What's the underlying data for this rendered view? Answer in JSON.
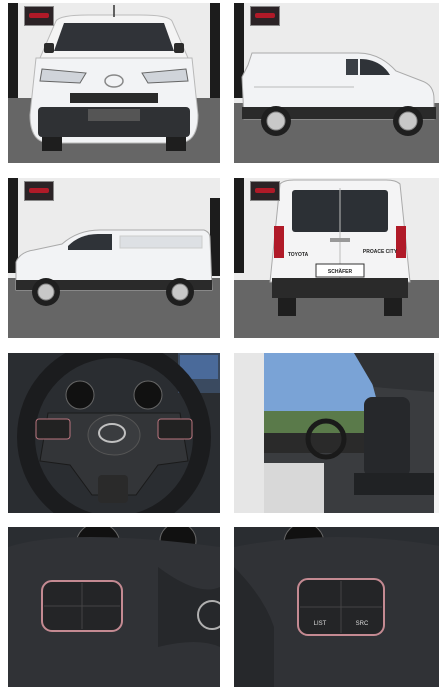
{
  "gallery": {
    "photos": [
      {
        "id": "front-view"
      },
      {
        "id": "right-side-view"
      },
      {
        "id": "left-side-view"
      },
      {
        "id": "rear-view"
      },
      {
        "id": "steering-wheel"
      },
      {
        "id": "cabin-interior"
      },
      {
        "id": "left-wheel-controls"
      },
      {
        "id": "right-wheel-controls"
      }
    ]
  },
  "rear_plate": {
    "text": "SCHÄFER"
  },
  "rear_badge": {
    "brand": "TOYOTA",
    "model": "PROACE CITY"
  },
  "wheel_buttons": {
    "list": "LIST",
    "src": "SRC"
  },
  "colors": {
    "van_white": "#f2f3f5",
    "studio_wall": "#ececec",
    "studio_floor": "#676767",
    "dealer_badge": "#b01a28",
    "interior_dark": "#2a2d31"
  }
}
